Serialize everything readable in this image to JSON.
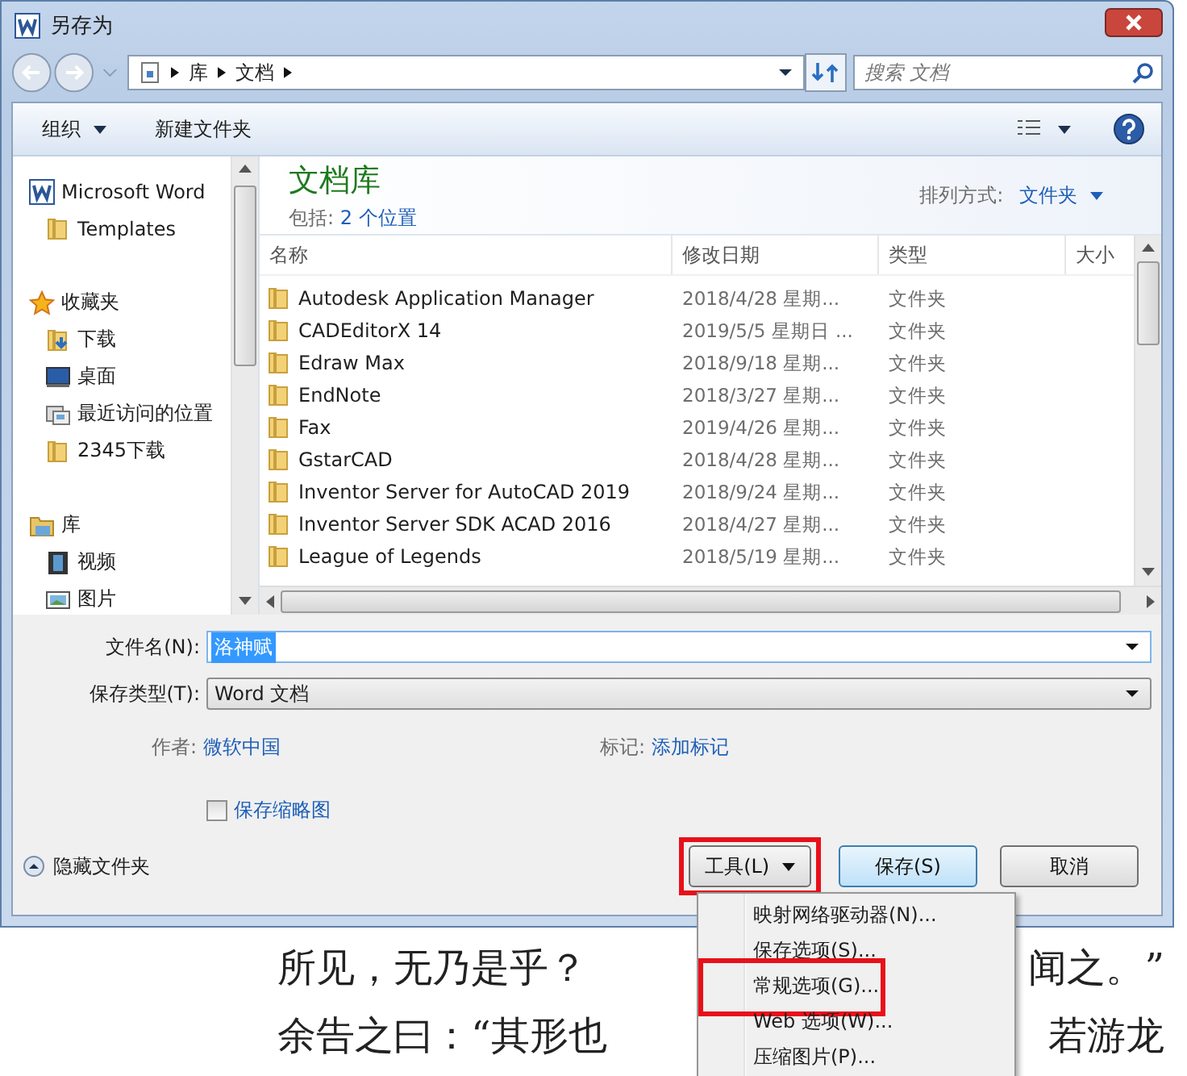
{
  "window": {
    "title": "另存为"
  },
  "address": {
    "path": [
      "库",
      "文档"
    ],
    "search_placeholder": "搜索 文档"
  },
  "toolbar": {
    "organize": "组织",
    "new_folder": "新建文件夹"
  },
  "nav": {
    "groups": [
      {
        "label": "Microsoft Word",
        "kind": "word",
        "children": [
          {
            "label": "Templates",
            "kind": "folder"
          }
        ]
      },
      {
        "label": "收藏夹",
        "kind": "star",
        "children": [
          {
            "label": "下载",
            "kind": "download"
          },
          {
            "label": "桌面",
            "kind": "desktop"
          },
          {
            "label": "最近访问的位置",
            "kind": "recent"
          },
          {
            "label": "2345下载",
            "kind": "folder"
          }
        ]
      },
      {
        "label": "库",
        "kind": "library",
        "children": [
          {
            "label": "视频",
            "kind": "video"
          },
          {
            "label": "图片",
            "kind": "image"
          }
        ]
      }
    ]
  },
  "library": {
    "title": "文档库",
    "includes_label": "包括:",
    "includes_link": "2 个位置",
    "sort_label": "排列方式:",
    "sort_value": "文件夹"
  },
  "table": {
    "columns": [
      "名称",
      "修改日期",
      "类型",
      "大小"
    ],
    "rows": [
      {
        "name": "Autodesk Application Manager",
        "date": "2018/4/28 星期...",
        "type": "文件夹"
      },
      {
        "name": "CADEditorX 14",
        "date": "2019/5/5 星期日 ...",
        "type": "文件夹"
      },
      {
        "name": "Edraw Max",
        "date": "2018/9/18 星期...",
        "type": "文件夹"
      },
      {
        "name": "EndNote",
        "date": "2018/3/27 星期...",
        "type": "文件夹"
      },
      {
        "name": "Fax",
        "date": "2019/4/26 星期...",
        "type": "文件夹"
      },
      {
        "name": "GstarCAD",
        "date": "2018/4/28 星期...",
        "type": "文件夹"
      },
      {
        "name": "Inventor Server for AutoCAD 2019",
        "date": "2018/9/24 星期...",
        "type": "文件夹"
      },
      {
        "name": "Inventor Server SDK ACAD 2016",
        "date": "2018/4/27 星期...",
        "type": "文件夹"
      },
      {
        "name": "League of Legends",
        "date": "2018/5/19 星期...",
        "type": "文件夹"
      }
    ]
  },
  "form": {
    "filename_label": "文件名(N):",
    "filename": "洛神赋",
    "filename_selected": true,
    "type_label": "保存类型(T):",
    "type_value": "Word 文档",
    "author_label": "作者:",
    "author": "微软中国",
    "tags_label": "标记:",
    "tags": "添加标记",
    "thumbnail_label": "保存缩略图",
    "thumbnail_checked": false
  },
  "footer": {
    "hide_folders": "隐藏文件夹",
    "tools": {
      "label": "工具(L)",
      "highlighted": true
    },
    "save": "保存(S)",
    "cancel": "取消"
  },
  "menu": {
    "items": [
      {
        "label": "映射网络驱动器(N)...",
        "highlighted": false
      },
      {
        "label": "保存选项(S)...",
        "highlighted": false
      },
      {
        "label": "常规选项(G)...",
        "highlighted": true
      },
      {
        "label": "Web 选项(W)...",
        "highlighted": false
      },
      {
        "label": "压缩图片(P)...",
        "highlighted": false
      }
    ]
  },
  "document": {
    "lines": [
      {
        "left": "所见，无乃是乎？",
        "right": "闻之。”"
      },
      {
        "left": "余告之曰：“其形也",
        "right": "若游龙"
      }
    ]
  }
}
